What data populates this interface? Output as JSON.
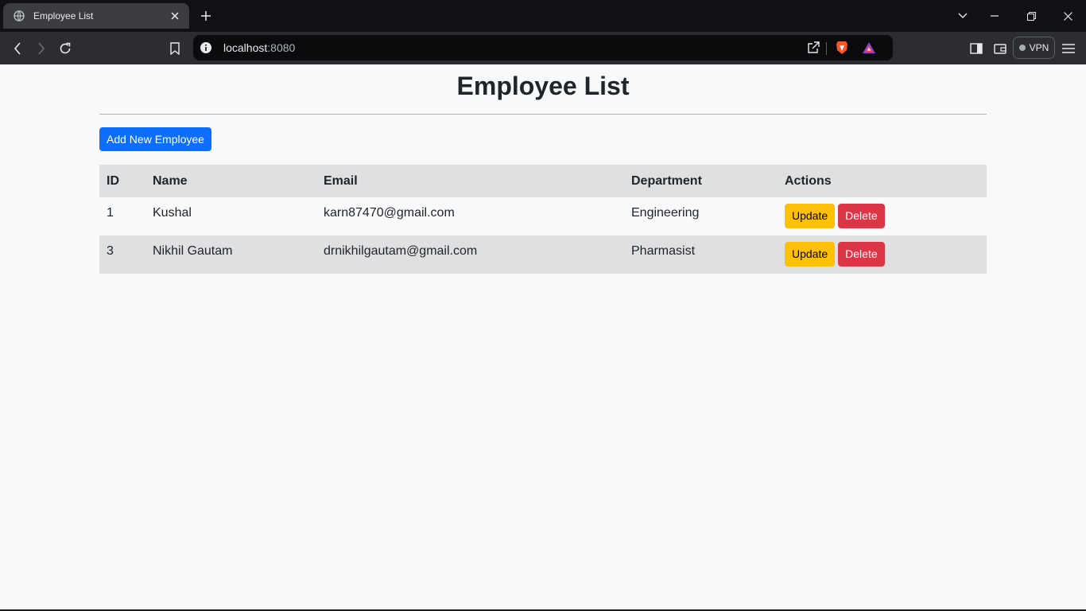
{
  "browser": {
    "tab": {
      "title": "Employee List",
      "favicon": "globe-icon"
    },
    "address": {
      "host": "localhost",
      "port": ":8080"
    },
    "vpn_label": "VPN"
  },
  "page": {
    "title": "Employee List",
    "add_button_label": "Add New Employee",
    "table": {
      "headers": [
        "ID",
        "Name",
        "Email",
        "Department",
        "Actions"
      ],
      "rows": [
        {
          "id": "1",
          "name": "Kushal",
          "email": "karn87470@gmail.com",
          "department": "Engineering",
          "update_label": "Update",
          "delete_label": "Delete"
        },
        {
          "id": "3",
          "name": "Nikhil Gautam",
          "email": "drnikhilgautam@gmail.com",
          "department": "Pharmasist",
          "update_label": "Update",
          "delete_label": "Delete"
        }
      ]
    }
  },
  "colors": {
    "primary": "#0d6efd",
    "warning": "#ffc107",
    "danger": "#dc3545",
    "page_bg": "#f8f9fa",
    "stripe": "#dfe0e2"
  }
}
